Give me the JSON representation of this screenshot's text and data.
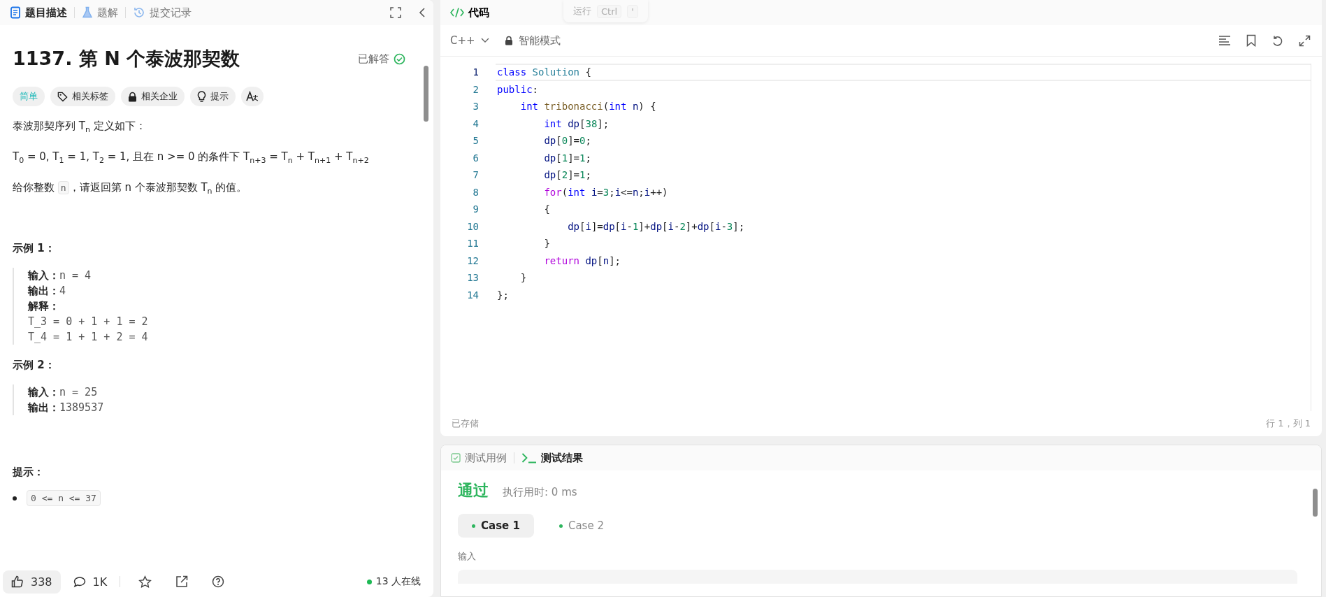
{
  "left_tabs": [
    {
      "label": "题目描述",
      "selected": true
    },
    {
      "label": "题解",
      "selected": false
    },
    {
      "label": "提交记录",
      "selected": false
    }
  ],
  "problem": {
    "title": "1137. 第 N 个泰波那契数",
    "status": "已解答",
    "solved": true,
    "tags": [
      {
        "kind": "difficulty",
        "label": "简单"
      },
      {
        "kind": "tag",
        "label": "相关标签"
      },
      {
        "kind": "lock",
        "label": "相关企业"
      },
      {
        "kind": "hint",
        "label": "提示"
      },
      {
        "kind": "translate"
      }
    ],
    "paragraphs": [
      [
        {
          "kind": "text",
          "text": "泰波那契序列 T$_{n}$ 定义如下："
        }
      ],
      [
        {
          "kind": "text",
          "text": "T$_{0}$ = 0, T$_{1}$ = 1, T$_{2}$ = 1, 且在 n >= 0 的条件下 T$_{n+3}$ = T$_{n}$ + T$_{n+1}$ + T$_{n+2}$"
        }
      ],
      [
        {
          "kind": "text",
          "text": "给你整数 "
        },
        {
          "kind": "code",
          "text": "n"
        },
        {
          "kind": "text",
          "text": "，请返回第 n 个泰波那契数 T$_{n}$ 的值。"
        }
      ]
    ],
    "examples": [
      {
        "title": "示例 1：",
        "fields": [
          {
            "label": "输入：",
            "value": "n = 4"
          },
          {
            "label": "输出：",
            "value": "4"
          },
          {
            "label": "解释："
          }
        ],
        "explanation": [
          "T_3 = 0 + 1 + 1 = 2",
          "T_4 = 1 + 1 + 2 = 4"
        ]
      },
      {
        "title": "示例 2：",
        "fields": [
          {
            "label": "输入：",
            "value": "n = 25"
          },
          {
            "label": "输出：",
            "value": "1389537"
          }
        ]
      }
    ],
    "hints_title": "提示：",
    "constraints": [
      "0 <= n <= 37"
    ]
  },
  "footer": {
    "likes": "338",
    "comments": "1K",
    "online": "13 人在线"
  },
  "editor": {
    "tab": "代码",
    "run_hint": {
      "label": "运行",
      "keys": [
        "Ctrl",
        "'"
      ]
    },
    "language": "C++",
    "mode": "智能模式",
    "lines": [
      [
        {
          "kind": "keyword",
          "text": "class"
        },
        {
          "kind": "type",
          "text": " Solution"
        },
        {
          "kind": "plain",
          "text": " {"
        }
      ],
      [
        {
          "kind": "keyword",
          "text": "public"
        },
        {
          "kind": "plain",
          "text": ":"
        }
      ],
      [
        {
          "kind": "keyword",
          "text": "    int"
        },
        {
          "kind": "function",
          "text": " tribonacci"
        },
        {
          "kind": "plain",
          "text": "("
        },
        {
          "kind": "keyword",
          "text": "int"
        },
        {
          "kind": "variable",
          "text": " n"
        },
        {
          "kind": "plain",
          "text": ") {"
        }
      ],
      [
        {
          "kind": "keyword",
          "text": "        int"
        },
        {
          "kind": "variable",
          "text": " dp"
        },
        {
          "kind": "plain",
          "text": "["
        },
        {
          "kind": "number",
          "text": "38"
        },
        {
          "kind": "plain",
          "text": "];"
        }
      ],
      [
        {
          "kind": "variable",
          "text": "        dp"
        },
        {
          "kind": "plain",
          "text": "["
        },
        {
          "kind": "number",
          "text": "0"
        },
        {
          "kind": "plain",
          "text": "]="
        },
        {
          "kind": "number",
          "text": "0"
        },
        {
          "kind": "plain",
          "text": ";"
        }
      ],
      [
        {
          "kind": "variable",
          "text": "        dp"
        },
        {
          "kind": "plain",
          "text": "["
        },
        {
          "kind": "number",
          "text": "1"
        },
        {
          "kind": "plain",
          "text": "]="
        },
        {
          "kind": "number",
          "text": "1"
        },
        {
          "kind": "plain",
          "text": ";"
        }
      ],
      [
        {
          "kind": "variable",
          "text": "        dp"
        },
        {
          "kind": "plain",
          "text": "["
        },
        {
          "kind": "number",
          "text": "2"
        },
        {
          "kind": "plain",
          "text": "]="
        },
        {
          "kind": "number",
          "text": "1"
        },
        {
          "kind": "plain",
          "text": ";"
        }
      ],
      [
        {
          "kind": "control",
          "text": "        for"
        },
        {
          "kind": "plain",
          "text": "("
        },
        {
          "kind": "keyword",
          "text": "int"
        },
        {
          "kind": "variable",
          "text": " i"
        },
        {
          "kind": "plain",
          "text": "="
        },
        {
          "kind": "number",
          "text": "3"
        },
        {
          "kind": "plain",
          "text": ";"
        },
        {
          "kind": "variable",
          "text": "i"
        },
        {
          "kind": "plain",
          "text": "<="
        },
        {
          "kind": "variable",
          "text": "n"
        },
        {
          "kind": "plain",
          "text": ";"
        },
        {
          "kind": "variable",
          "text": "i"
        },
        {
          "kind": "plain",
          "text": "++)"
        }
      ],
      [
        {
          "kind": "plain",
          "text": "        {"
        }
      ],
      [
        {
          "kind": "variable",
          "text": "            dp"
        },
        {
          "kind": "plain",
          "text": "["
        },
        {
          "kind": "variable",
          "text": "i"
        },
        {
          "kind": "plain",
          "text": "]="
        },
        {
          "kind": "variable",
          "text": "dp"
        },
        {
          "kind": "plain",
          "text": "["
        },
        {
          "kind": "variable",
          "text": "i"
        },
        {
          "kind": "plain",
          "text": "-"
        },
        {
          "kind": "number",
          "text": "1"
        },
        {
          "kind": "plain",
          "text": "]+"
        },
        {
          "kind": "variable",
          "text": "dp"
        },
        {
          "kind": "plain",
          "text": "["
        },
        {
          "kind": "variable",
          "text": "i"
        },
        {
          "kind": "plain",
          "text": "-"
        },
        {
          "kind": "number",
          "text": "2"
        },
        {
          "kind": "plain",
          "text": "]+"
        },
        {
          "kind": "variable",
          "text": "dp"
        },
        {
          "kind": "plain",
          "text": "["
        },
        {
          "kind": "variable",
          "text": "i"
        },
        {
          "kind": "plain",
          "text": "-"
        },
        {
          "kind": "number",
          "text": "3"
        },
        {
          "kind": "plain",
          "text": "];"
        }
      ],
      [
        {
          "kind": "plain",
          "text": "        }"
        }
      ],
      [
        {
          "kind": "control",
          "text": "        return"
        },
        {
          "kind": "variable",
          "text": " dp"
        },
        {
          "kind": "plain",
          "text": "["
        },
        {
          "kind": "variable",
          "text": "n"
        },
        {
          "kind": "plain",
          "text": "];"
        }
      ],
      [
        {
          "kind": "plain",
          "text": "    }"
        }
      ],
      [
        {
          "kind": "plain",
          "text": "};"
        }
      ]
    ],
    "line_numbers": [
      "1",
      "2",
      "3",
      "4",
      "5",
      "6",
      "7",
      "8",
      "9",
      "10",
      "11",
      "12",
      "13",
      "14"
    ],
    "saved": "已存储",
    "cursor": "行 1，列 1"
  },
  "console": {
    "tabs": [
      {
        "label": "测试用例",
        "selected": false
      },
      {
        "label": "测试结果",
        "selected": true
      }
    ],
    "verdict": "通过",
    "runtime": "执行用时: 0 ms",
    "cases": [
      {
        "label": "Case 1",
        "selected": true
      },
      {
        "label": "Case 2",
        "selected": false
      }
    ],
    "input_label": "输入"
  }
}
